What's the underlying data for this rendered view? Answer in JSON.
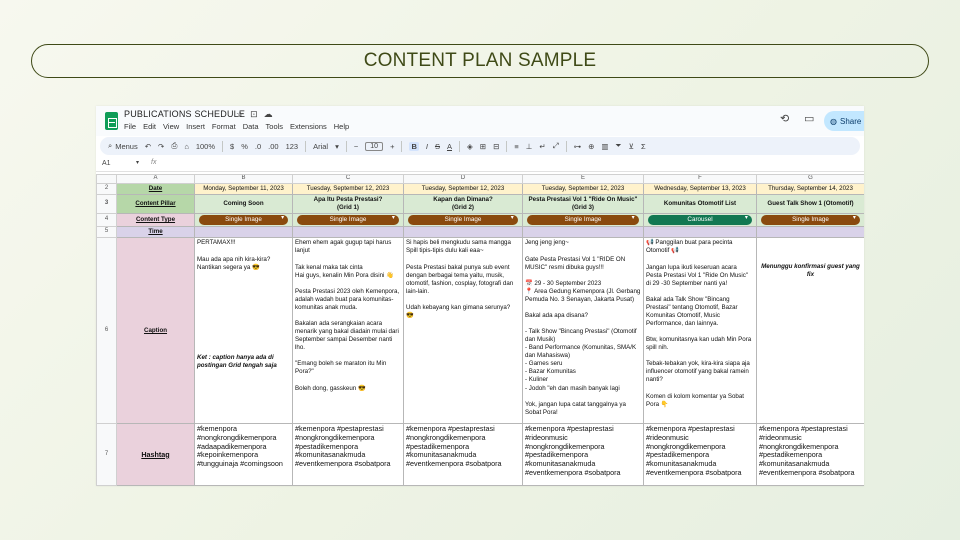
{
  "slide": {
    "title": "CONTENT PLAN SAMPLE"
  },
  "app": {
    "doc_title": "PUBLICATIONS SCHEDULE",
    "title_icons": [
      "star-icon",
      "folder-move-icon",
      "cloud-status-icon"
    ],
    "menu": [
      "File",
      "Edit",
      "View",
      "Insert",
      "Format",
      "Data",
      "Tools",
      "Extensions",
      "Help"
    ],
    "share_label": "Share"
  },
  "toolbar": {
    "menus_label": "Menus",
    "zoom": "100%",
    "currency": "$",
    "percent": "%",
    "decrease_decimal": ".0",
    "increase_decimal": ".00",
    "number_format": "123",
    "font": "Arial",
    "font_size": "10",
    "bold": "B",
    "italic": "I",
    "strike": "S",
    "text_color": "A",
    "sigma": "Σ"
  },
  "formula_bar": {
    "cell_ref": "A1",
    "fx": "fx"
  },
  "columns": [
    "A",
    "B",
    "C",
    "D",
    "E",
    "F",
    "G"
  ],
  "rows": {
    "r2": {
      "num": "2",
      "label": "Date",
      "cells": [
        "Monday, September 11, 2023",
        "Tuesday, September 12, 2023",
        "Tuesday, September 12, 2023",
        "Tuesday, September 12, 2023",
        "Wednesday, September 13, 2023",
        "Thursday, September 14, 2023"
      ]
    },
    "r3": {
      "num": "3",
      "label": "Content Pillar",
      "cells": [
        "Coming Soon",
        "Apa Itu Pesta Prestasi?\n(Grid 1)",
        "Kapan dan Dimana?\n(Grid 2)",
        "Pesta Prestasi Vol 1 \"Ride On Music\"\n(Grid 3)",
        "Komunitas Otomotif List",
        "Guest Talk Show 1 (Otomotif)"
      ]
    },
    "r4": {
      "num": "4",
      "label": "Content Type",
      "cells": [
        "Single Image",
        "Single Image",
        "Single Image",
        "Single Image",
        "Carousel",
        "Single Image"
      ]
    },
    "r5": {
      "num": "5",
      "label": "Time"
    },
    "r6": {
      "num": "6",
      "label": "Caption",
      "cells": [
        "PERTAMAX!!!\n\nMau ada apa nih kira-kira?\nNantikan segera ya 😎",
        "Ehem ehem agak gugup tapi harus lanjut\n\nTak kenal maka tak cinta\nHai guys, kenalin Min Pora disini 👋\n\nPesta Prestasi 2023 oleh Kemenpora, adalah wadah buat para komunitas-komunitas anak muda.\n\nBakalan ada serangkaian acara menarik yang bakal diadain mulai dari September sampai Desember nanti lho.\n\n\"Emang boleh se maraton itu Min Pora?\"\n\nBoleh dong, gasskeun 😎",
        "Si hapis beli mengkudu sama mangga\nSpill tipis-tipis dulu kali eaa~\n\nPesta Prestasi bakal punya sub event dengan berbagai tema yaitu, musik, otomotif, fashion, cosplay, fotografi dan lain-lain.\n\nUdah kebayang kan gimana serunya?\n😎",
        "Jeng jeng jeng~\n\nGate Pesta Prestasi Vol 1 \"RIDE ON MUSIC\" resmi dibuka guys!!!\n\n📅 29 - 30 September 2023\n📍 Area Gedung Kemenpora (Jl. Gerbang Pemuda No. 3 Senayan, Jakarta Pusat)\n\nBakal ada apa disana?\n\n- Talk Show \"Bincang Prestasi\" (Otomotif dan Musik)\n- Band Performance (Komunitas, SMA/K dan Mahasiswa)\n- Games seru\n- Bazar Komunitas\n- Kuliner\n- Jodoh \"eh dan masih banyak lagi\n\nYok, jangan lupa catat tanggalnya ya Sobat Pora!",
        "📢 Panggilan buat para pecinta Otomotif 📢\n\nJangan lupa ikuti keseruan acara Pesta Prestasi Vol 1 \"Ride On Music\" di 29 -30 September nanti ya!\n\nBakal ada Talk Show \"Bincang Prestasi\" tentang Otomotif, Bazar Komunitas Otomotif, Music Performance, dan lainnya.\n\nBtw, komunitasnya kan udah Min Pora spill nih.\n\nTebak-tebakan yok, kira-kira siapa aja influencer otomotif yang bakal ramein nanti?\n\nKomen di kolom komentar ya Sobat Pora 👇",
        "Menunggu konfirmasi guest yang fix"
      ],
      "note_b": "Ket : caption hanya ada di postingan Grid tengah saja"
    },
    "r7": {
      "num": "7",
      "label": "Hashtag",
      "cells": [
        "#kemenpora\n#nongkrongdikemenpora\n#adaapadikemenpora\n#kepoinkemenpora\n#tungguinaja #comingsoon",
        "#kemenpora #pestaprestasi\n#nongkrongdikemenpora\n#pestadikemenpora\n#komunitasanakmuda\n#eventkemenpora #sobatpora",
        "#kemenpora #pestaprestasi\n#nongkrongdikemenpora\n#pestadikemenpora\n#komunitasanakmuda\n#eventkemenpora #sobatpora",
        "#kemenpora #pestaprestasi\n#rideonmusic\n#nongkrongdikemenpora\n#pestadikemenpora\n#komunitasanakmuda\n#eventkemenpora #sobatpora",
        "#kemenpora #pestaprestasi\n#rideonmusic\n#nongkrongdikemenpora\n#pestadikemenpora\n#komunitasanakmuda\n#eventkemenpora #sobatpora",
        "#kemenpora #pestaprestasi\n#rideonmusic\n#nongkrongdikemenpora\n#pestadikemenpora\n#komunitasanakmuda\n#eventkemenpora #sobatpora"
      ]
    }
  },
  "colors": {
    "title_text": "#3f4a17",
    "single_image_chip": "#8a4a0e",
    "carousel_chip": "#127852",
    "label_green": "#b6d7a8",
    "label_pink": "#ead1dc",
    "label_purple": "#d9d2e9",
    "date_fill": "#fff2cc",
    "pillar_fill": "#d9ead3"
  }
}
